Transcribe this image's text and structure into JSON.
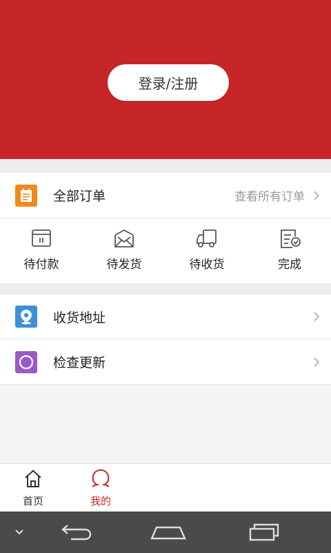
{
  "header": {
    "login_label": "登录/注册"
  },
  "orders": {
    "title": "全部订单",
    "view_all": "查看所有订单",
    "statuses": [
      {
        "label": "待付款",
        "icon": "wallet-icon"
      },
      {
        "label": "待发货",
        "icon": "envelope-box-icon"
      },
      {
        "label": "待收货",
        "icon": "truck-icon"
      },
      {
        "label": "完成",
        "icon": "checklist-icon"
      }
    ]
  },
  "menu": [
    {
      "label": "收货地址",
      "icon": "location-pin-icon",
      "icon_color": "#3f8fd8"
    },
    {
      "label": "检查更新",
      "icon": "refresh-circle-icon",
      "icon_color": "#9b59c7"
    }
  ],
  "tabbar": {
    "tabs": [
      {
        "label": "首页",
        "icon": "home-icon",
        "active": false
      },
      {
        "label": "我的",
        "icon": "user-icon",
        "active": true
      }
    ]
  },
  "colors": {
    "accent": "#c62627",
    "orders_icon": "#f08a1c",
    "inactive": "#333333"
  }
}
